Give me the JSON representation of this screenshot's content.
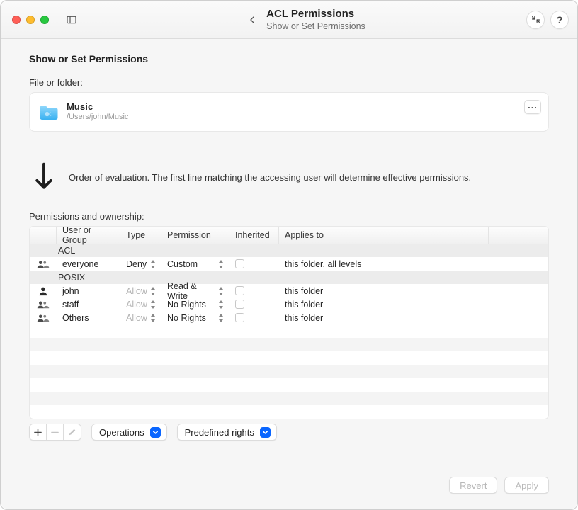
{
  "header": {
    "title": "ACL Permissions",
    "subtitle": "Show or Set Permissions"
  },
  "page_title": "Show or Set Permissions",
  "file_field_label": "File or folder:",
  "file": {
    "name": "Music",
    "path": "/Users/john/Music"
  },
  "order_hint": "Order of evaluation. The first line matching the accessing user will determine effective permissions.",
  "perms_label": "Permissions and ownership:",
  "columns": {
    "user": "User or Group",
    "type": "Type",
    "perm": "Permission",
    "inh": "Inherited",
    "app": "Applies to"
  },
  "sections": {
    "acl": "ACL",
    "posix": "POSIX"
  },
  "rows": {
    "acl0": {
      "principal": "everyone",
      "type": "Deny",
      "type_dim": false,
      "perm": "Custom",
      "applies": "this folder, all levels",
      "icon": "group"
    },
    "pos0": {
      "principal": "john",
      "type": "Allow",
      "type_dim": true,
      "perm": "Read & Write",
      "applies": "this folder",
      "icon": "user"
    },
    "pos1": {
      "principal": "staff",
      "type": "Allow",
      "type_dim": true,
      "perm": "No Rights",
      "applies": "this folder",
      "icon": "group"
    },
    "pos2": {
      "principal": "Others",
      "type": "Allow",
      "type_dim": true,
      "perm": "No Rights",
      "applies": "this folder",
      "icon": "group"
    }
  },
  "toolbar": {
    "operations": "Operations",
    "predefined": "Predefined rights"
  },
  "buttons": {
    "revert": "Revert",
    "apply": "Apply"
  },
  "help_glyph": "?"
}
